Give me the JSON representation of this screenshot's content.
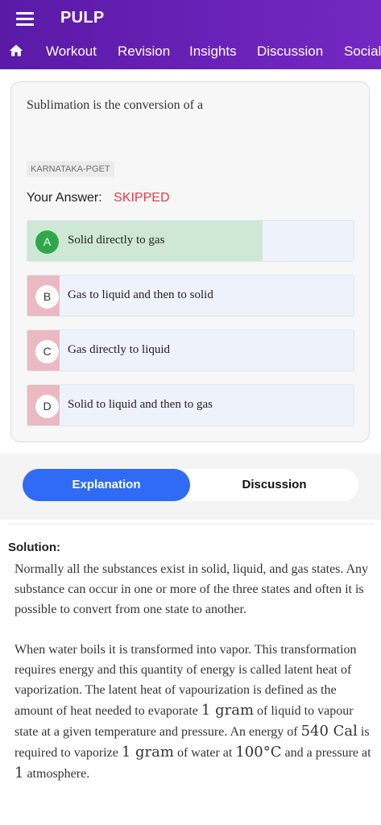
{
  "app": {
    "title": "PULP"
  },
  "nav": {
    "icons": {
      "menu": "menu-icon",
      "home": "home-icon"
    },
    "tabs": [
      "Workout",
      "Revision",
      "Insights",
      "Discussion",
      "Social"
    ]
  },
  "question": {
    "text": "Sublimation is the conversion of a",
    "exam_tag": "KARNATAKA-PGET",
    "your_answer_label": "Your Answer:",
    "your_answer_value": "SKIPPED",
    "options": [
      {
        "letter": "A",
        "text": "Solid directly to gas",
        "correct": true,
        "percent_fill": 0.72
      },
      {
        "letter": "B",
        "text": "Gas to liquid and then to solid",
        "correct": false
      },
      {
        "letter": "C",
        "text": "Gas directly to liquid",
        "correct": false
      },
      {
        "letter": "D",
        "text": "Solid to liquid and then to gas",
        "correct": false
      }
    ]
  },
  "tabs": {
    "explanation": "Explanation",
    "discussion": "Discussion",
    "active": "explanation"
  },
  "solution": {
    "heading": "Solution:",
    "para1": "Normally all the substances exist in solid, liquid, and gas states. Any substance can   occur in one or more of the three states and often it is possible to convert from one state to another.",
    "para2_parts": [
      "When water boils it is transformed into vapor. This transformation requires energy and this quantity of energy is called latent heat of vaporization. The latent heat of vapourization is defined as the amount of heat needed to evaporate ",
      "1 gram",
      " of liquid to vapour state at a given temperature and pressure. An energy of ",
      "540 Cal",
      " is required to vaporize ",
      "1 gram",
      " of water at ",
      "100°C",
      " and a pressure at ",
      "1",
      " atmosphere."
    ]
  },
  "colors": {
    "appbar": "#6a22b8",
    "skipped": "#e03a4a",
    "correct": "#2fa84a",
    "active_tab": "#2f6bf5"
  }
}
